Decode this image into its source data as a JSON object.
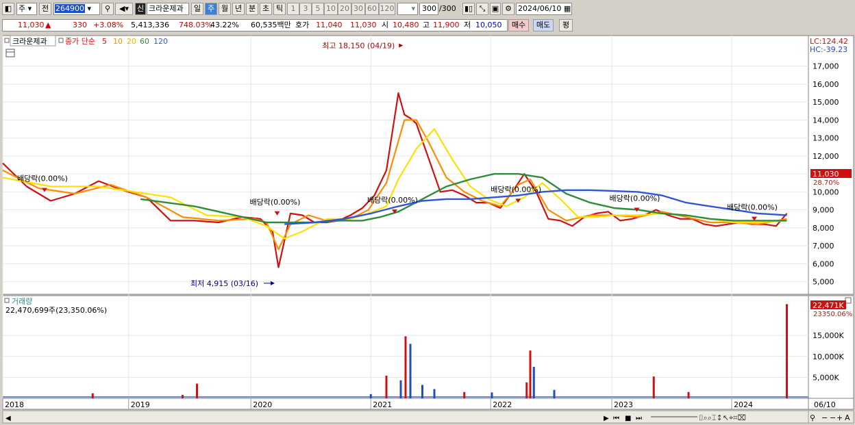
{
  "toolbar": {
    "mode": "주",
    "scope": "전",
    "code": "264900",
    "sin_badge": "신",
    "name": "크라운제과",
    "periods": [
      "일",
      "주",
      "월",
      "년",
      "분",
      "초",
      "틱"
    ],
    "active_period": "주",
    "minute_steps": [
      "1",
      "3",
      "5",
      "10",
      "20",
      "30",
      "60",
      "120"
    ],
    "count": "300",
    "count_total": "/300",
    "date": "2024/06/10"
  },
  "quote": {
    "price": "11,030",
    "arrow": "▲",
    "change": "330",
    "change_pct": "+3.08%",
    "volume": "5,413,336",
    "vol_ratio": "748.03%",
    "turnover": "43.22%",
    "amount": "60,535백만",
    "ask_label": "호가",
    "ask": "11,040",
    "bid": "11,030",
    "open_label": "시",
    "open": "10,480",
    "high_label": "고",
    "high": "11,900",
    "low_label": "저",
    "low": "10,050",
    "buy_label": "매수",
    "sell_label": "매도",
    "avg_label": "평"
  },
  "legend": {
    "name": "크라운제과",
    "ma_label": "종가 단순",
    "ma_periods": [
      "5",
      "10",
      "20",
      "60",
      "120"
    ]
  },
  "volume_panel": {
    "title": "거래량",
    "value_text": "22,470,699주(23,350.06%)",
    "last_tag": "22,471K",
    "last_pct": "23350.06%"
  },
  "price_panel": {
    "lc": "LC:124.42",
    "hc": "HC:-39.23",
    "last_tag": "11,030",
    "last_pct": "28.70%"
  },
  "bottom_date": "06/10",
  "chart_data": [
    {
      "type": "line",
      "title": "",
      "y_axis_ticks": [
        5000,
        6000,
        7000,
        8000,
        9000,
        10000,
        11000,
        12000,
        13000,
        14000,
        15000,
        16000,
        17000
      ],
      "y_axis_labels": [
        "5,000",
        "6,000",
        "7,000",
        "8,000",
        "9,000",
        "10,000",
        "11,000",
        "12,000",
        "13,000",
        "14,000",
        "15,000",
        "16,000",
        "17,000"
      ],
      "ylim": [
        4300,
        18700
      ],
      "x_labels": [
        "2018",
        "2019",
        "2020",
        "2021",
        "2022",
        "2023",
        "2024"
      ],
      "x_label_pos": [
        2017.9,
        2018.95,
        2019.97,
        2020.97,
        2021.97,
        2022.98,
        2023.98
      ],
      "xlim": [
        2017.9,
        2024.62
      ],
      "grid": true,
      "series": [
        {
          "name": "5",
          "color": "#d01010",
          "x": [
            2017.9,
            2018.1,
            2018.3,
            2018.5,
            2018.7,
            2018.9,
            2019.1,
            2019.3,
            2019.5,
            2019.7,
            2019.9,
            2020.05,
            2020.15,
            2020.2,
            2020.3,
            2020.4,
            2020.5,
            2020.6,
            2020.7,
            2020.8,
            2020.9,
            2021.0,
            2021.1,
            2021.2,
            2021.25,
            2021.3,
            2021.35,
            2021.45,
            2021.55,
            2021.65,
            2021.75,
            2021.85,
            2021.95,
            2022.05,
            2022.15,
            2022.25,
            2022.35,
            2022.45,
            2022.55,
            2022.65,
            2022.75,
            2022.85,
            2022.95,
            2023.05,
            2023.15,
            2023.25,
            2023.35,
            2023.45,
            2023.55,
            2023.65,
            2023.75,
            2023.85,
            2023.95,
            2024.05,
            2024.15,
            2024.25,
            2024.35,
            2024.44
          ],
          "y": [
            11600,
            10300,
            9500,
            9900,
            10600,
            10100,
            9700,
            8400,
            8400,
            8300,
            8600,
            8500,
            7800,
            5800,
            8800,
            8700,
            8300,
            8300,
            8400,
            8700,
            9100,
            9800,
            11200,
            15500,
            14300,
            14100,
            13800,
            11900,
            10000,
            10100,
            9800,
            9400,
            9400,
            9100,
            10000,
            11000,
            10000,
            8500,
            8400,
            8100,
            8600,
            8800,
            8900,
            8400,
            8500,
            8700,
            9000,
            8700,
            8500,
            8500,
            8200,
            8100,
            8200,
            8300,
            8200,
            8200,
            8100,
            8800
          ]
        },
        {
          "name": "10",
          "color": "#ff8c00",
          "x": [
            2017.9,
            2018.2,
            2018.5,
            2018.8,
            2019.1,
            2019.4,
            2019.7,
            2020.0,
            2020.1,
            2020.2,
            2020.3,
            2020.45,
            2020.6,
            2020.8,
            2020.95,
            2021.1,
            2021.25,
            2021.35,
            2021.45,
            2021.6,
            2021.75,
            2021.9,
            2022.05,
            2022.2,
            2022.3,
            2022.45,
            2022.6,
            2022.8,
            2023.0,
            2023.2,
            2023.4,
            2023.6,
            2023.8,
            2024.0,
            2024.2,
            2024.44
          ],
          "y": [
            11200,
            10200,
            9900,
            10400,
            9700,
            8600,
            8400,
            8500,
            8300,
            6800,
            8200,
            8700,
            8400,
            8500,
            9000,
            10500,
            14000,
            14000,
            12800,
            10800,
            10000,
            9500,
            9200,
            10400,
            10700,
            9000,
            8400,
            8700,
            8700,
            8600,
            8900,
            8600,
            8300,
            8300,
            8200,
            8500
          ]
        },
        {
          "name": "20",
          "color": "#ffe000",
          "x": [
            2017.9,
            2018.3,
            2018.7,
            2019.0,
            2019.3,
            2019.6,
            2019.9,
            2020.1,
            2020.25,
            2020.4,
            2020.6,
            2020.8,
            2020.95,
            2021.1,
            2021.2,
            2021.35,
            2021.5,
            2021.65,
            2021.8,
            2021.95,
            2022.1,
            2022.25,
            2022.4,
            2022.55,
            2022.7,
            2022.85,
            2023.0,
            2023.2,
            2023.4,
            2023.6,
            2023.8,
            2024.0,
            2024.2,
            2024.44
          ],
          "y": [
            10800,
            10300,
            10300,
            10000,
            9700,
            8700,
            8600,
            8100,
            7400,
            7800,
            8500,
            8500,
            8800,
            9200,
            10700,
            12400,
            13500,
            11800,
            10300,
            9600,
            9200,
            9700,
            10500,
            9600,
            8600,
            8600,
            8700,
            8700,
            8800,
            8700,
            8500,
            8300,
            8300,
            8400
          ]
        },
        {
          "name": "60",
          "color": "#2e8b3c",
          "x": [
            2019.05,
            2019.5,
            2019.9,
            2020.1,
            2020.3,
            2020.5,
            2020.7,
            2020.9,
            2021.05,
            2021.2,
            2021.4,
            2021.6,
            2021.8,
            2022.0,
            2022.2,
            2022.4,
            2022.6,
            2022.8,
            2023.0,
            2023.2,
            2023.4,
            2023.6,
            2023.8,
            2024.0,
            2024.2,
            2024.44
          ],
          "y": [
            9600,
            9200,
            8600,
            8300,
            8300,
            8300,
            8400,
            8400,
            8600,
            8900,
            9600,
            10300,
            10700,
            11000,
            11000,
            10800,
            9900,
            9400,
            9100,
            9000,
            8800,
            8700,
            8500,
            8400,
            8400,
            8400
          ]
        },
        {
          "name": "120",
          "color": "#2f56d6",
          "x": [
            2020.25,
            2020.5,
            2020.75,
            2020.97,
            2021.2,
            2021.4,
            2021.6,
            2021.8,
            2022.0,
            2022.2,
            2022.4,
            2022.6,
            2022.8,
            2023.0,
            2023.2,
            2023.4,
            2023.6,
            2023.8,
            2024.0,
            2024.2,
            2024.44
          ],
          "y": [
            8200,
            8300,
            8500,
            8800,
            9200,
            9500,
            9600,
            9600,
            9700,
            9800,
            10000,
            10100,
            10100,
            10050,
            10000,
            9800,
            9400,
            9200,
            9000,
            8800,
            8700
          ]
        }
      ],
      "annotations": [
        {
          "text": "최고 18,150 (04/19)",
          "x": 2021.25,
          "y": 18150,
          "color": "#b00000"
        },
        {
          "text": "최저 4,915 (03/16)",
          "x": 2020.18,
          "y": 4915,
          "color": "#00008b"
        },
        {
          "text": "배당락(0.00%)",
          "x": 2018.02,
          "y": 10600
        },
        {
          "text": "배당락(0.00%)",
          "x": 2019.96,
          "y": 9300
        },
        {
          "text": "배당락(0.00%)",
          "x": 2020.94,
          "y": 9400
        },
        {
          "text": "배당락(0.00%)",
          "x": 2021.97,
          "y": 10000
        },
        {
          "text": "배당락(0.00%)",
          "x": 2022.96,
          "y": 9500
        },
        {
          "text": "배당락(0.00%)",
          "x": 2023.94,
          "y": 9000
        }
      ]
    },
    {
      "type": "bar",
      "title": "거래량",
      "y_axis_labels": [
        "5,000K",
        "10,000K",
        "15,000K"
      ],
      "y_axis_ticks": [
        5000,
        10000,
        15000
      ],
      "ylim": [
        0,
        24500
      ],
      "x": [
        2018.65,
        2019.4,
        2019.52,
        2020.97,
        2021.1,
        2021.22,
        2021.26,
        2021.3,
        2021.4,
        2021.5,
        2021.75,
        2021.98,
        2022.27,
        2022.3,
        2022.33,
        2022.5,
        2023.33,
        2023.62,
        2024.44
      ],
      "values": [
        1200,
        800,
        3500,
        1000,
        5400,
        4300,
        14800,
        13000,
        3200,
        2200,
        1500,
        1400,
        3800,
        11400,
        7500,
        2000,
        5200,
        1500,
        22471
      ],
      "colors": [
        "#d01010",
        "#d01010",
        "#d01010",
        "#1f4fbf",
        "#d01010",
        "#1f4fbf",
        "#d01010",
        "#1f4fbf",
        "#1f4fbf",
        "#1f4fbf",
        "#d01010",
        "#1f4fbf",
        "#d01010",
        "#d01010",
        "#1f4fbf",
        "#1f4fbf",
        "#d01010",
        "#d01010",
        "#d01010"
      ]
    }
  ]
}
